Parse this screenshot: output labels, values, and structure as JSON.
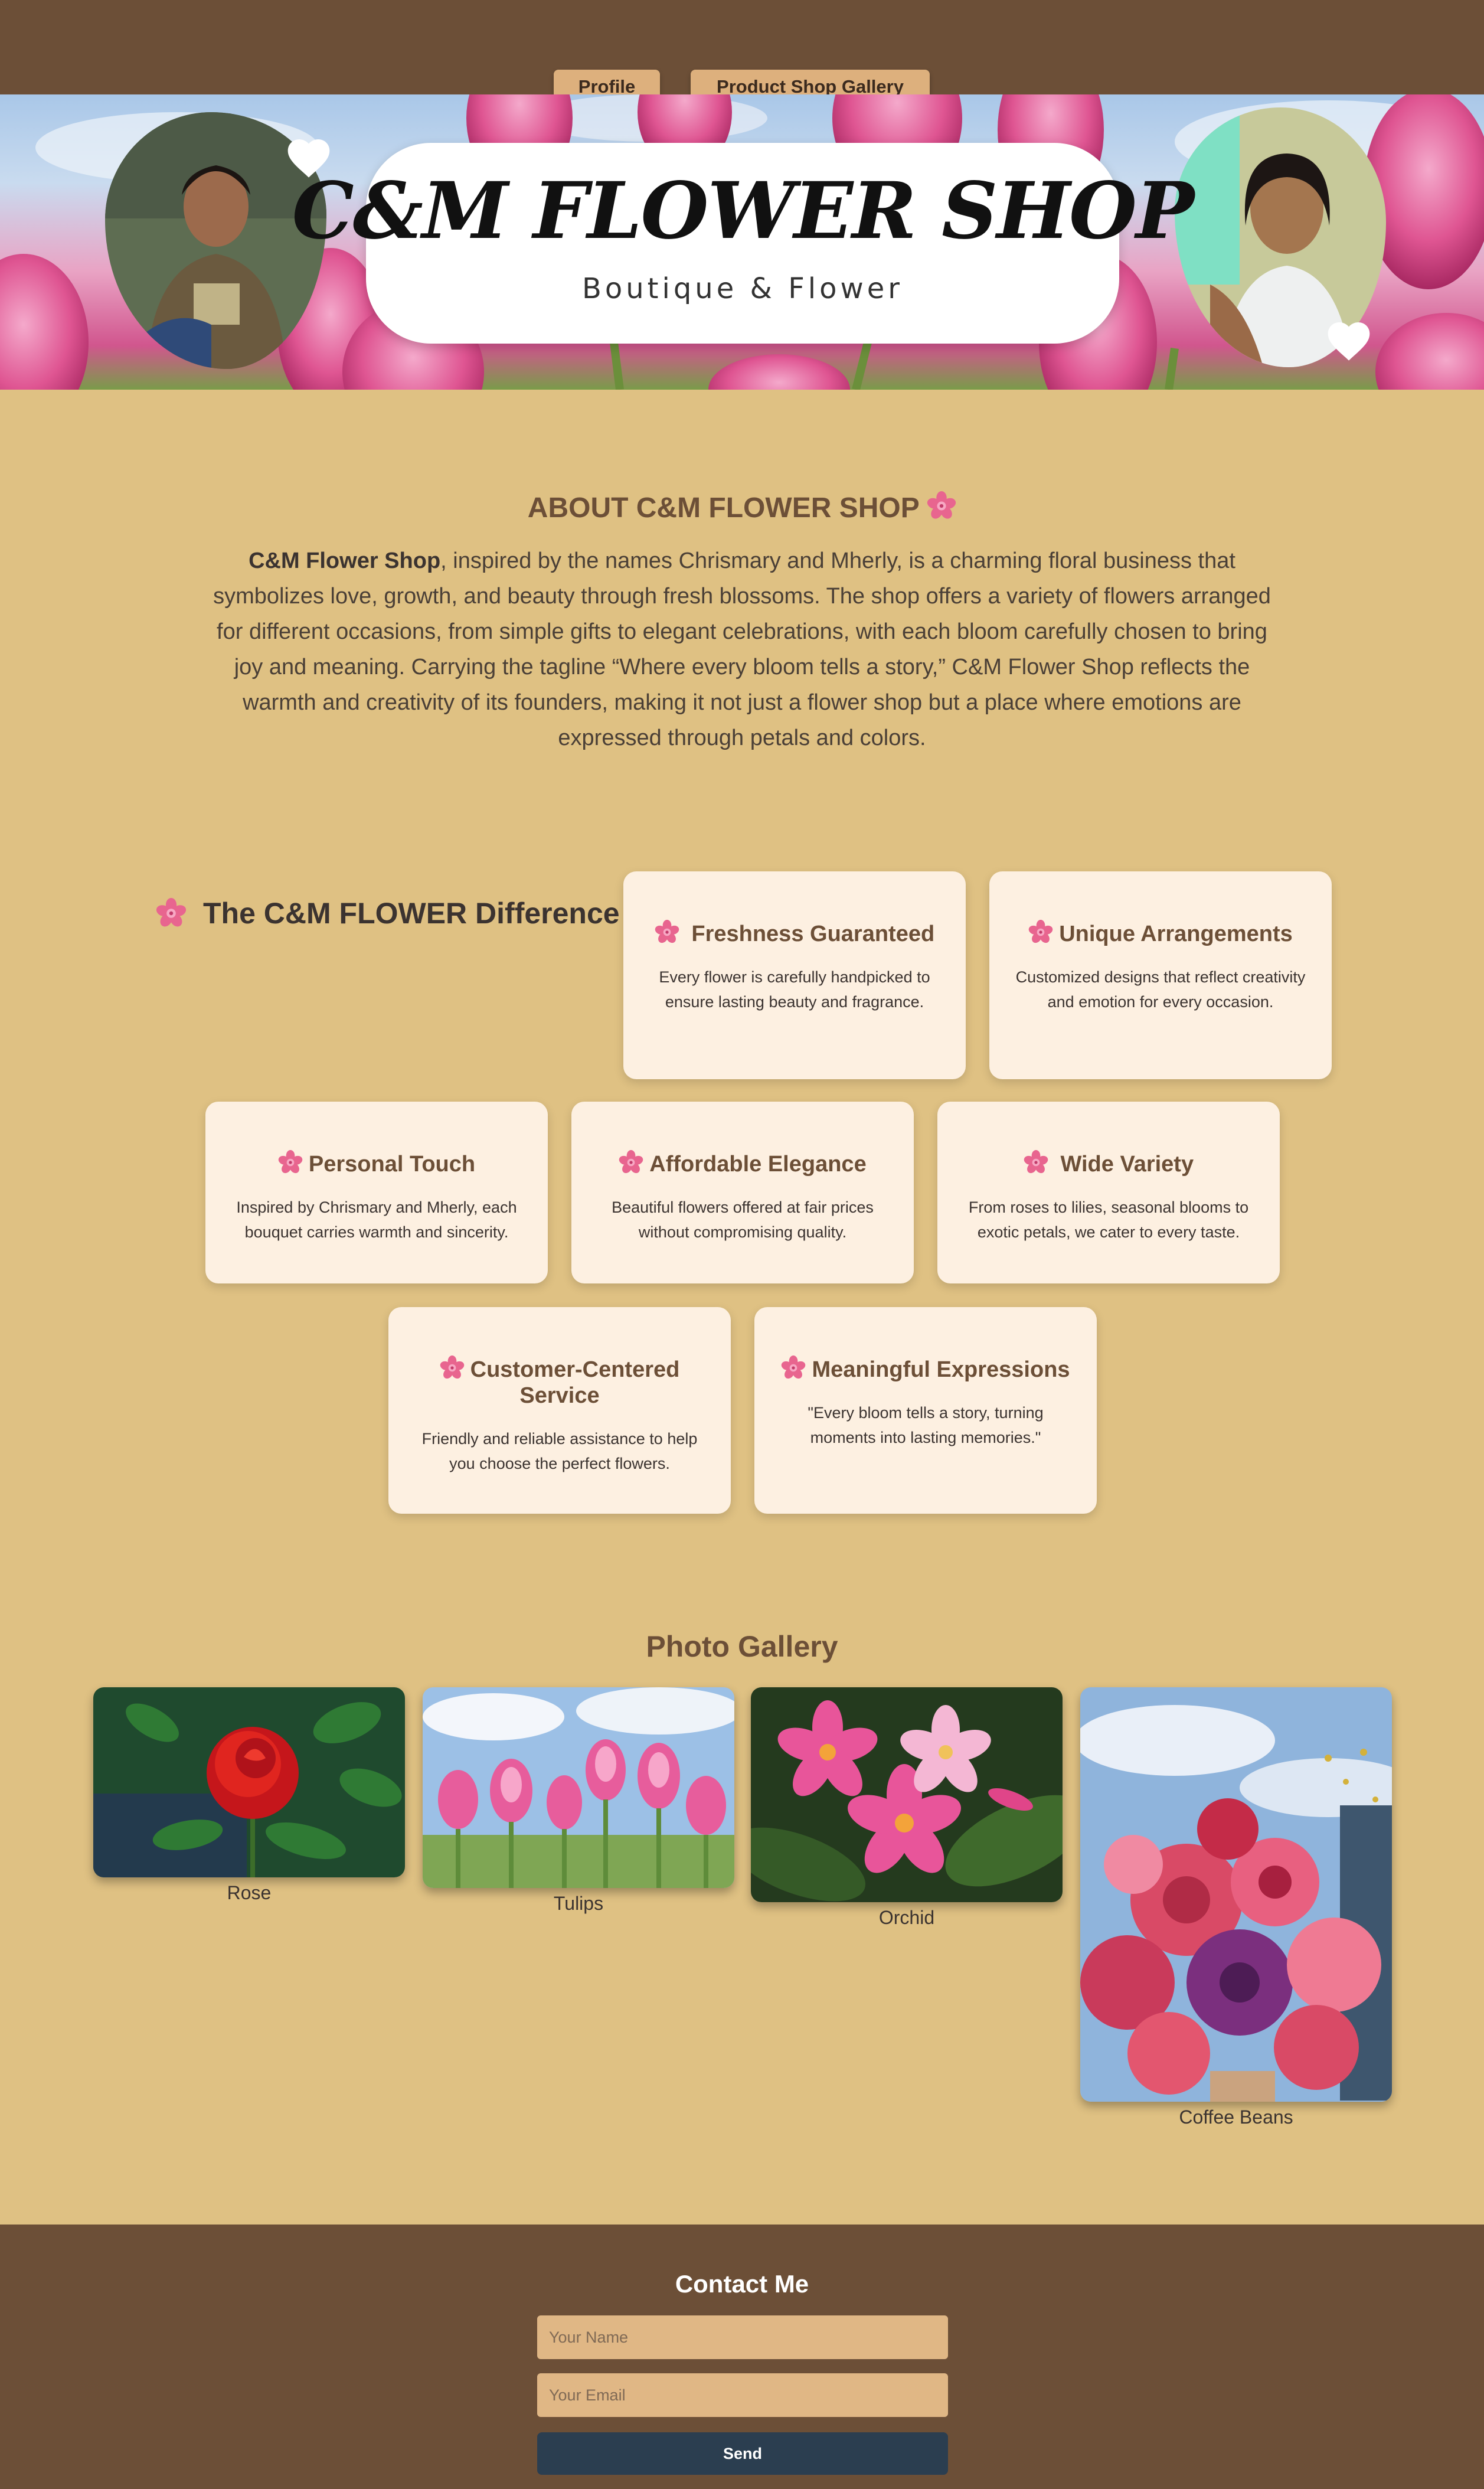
{
  "nav": {
    "profile_label": "Profile",
    "gallery_label": "Product Shop Gallery"
  },
  "hero": {
    "title": "C&M FLOWER SHOP",
    "subtitle": "Boutique & Flower"
  },
  "about": {
    "title": "ABOUT C&M FLOWER SHOP",
    "lead_bold": "C&M Flower Shop",
    "text": ", inspired by the names Chrismary and Mherly, is a charming floral business that symbolizes love, growth, and beauty through fresh blossoms. The shop offers a variety of flowers arranged for different occasions, from simple gifts to elegant celebrations, with each bloom carefully chosen to bring joy and meaning. Carrying the tagline “Where every bloom tells a story,” C&M Flower Shop reflects the warmth and creativity of its founders, making it not just a flower shop but a place where emotions are expressed through petals and colors."
  },
  "difference": {
    "heading": "The C&M FLOWER Difference",
    "cards": [
      {
        "title": "Freshness Guaranteed",
        "desc": "Every flower is carefully handpicked to ensure lasting beauty and fragrance."
      },
      {
        "title": "Unique Arrangements",
        "desc": "Customized designs that reflect creativity and emotion for every occasion."
      },
      {
        "title": "Personal Touch",
        "desc": "Inspired by Chrismary and Mherly, each bouquet carries warmth and sincerity."
      },
      {
        "title": "Affordable Elegance",
        "desc": "Beautiful flowers offered at fair prices without compromising quality."
      },
      {
        "title": "Wide Variety",
        "desc": "From roses to lilies, seasonal blooms to exotic petals, we cater to every taste."
      },
      {
        "title": "Customer-Centered Service",
        "desc": "Friendly and reliable assistance to help you choose the perfect flowers."
      },
      {
        "title": "Meaningful Expressions",
        "desc": "\"Every bloom tells a story, turning moments into lasting memories.\""
      }
    ]
  },
  "gallery": {
    "title": "Photo Gallery",
    "items": [
      {
        "caption": "Rose"
      },
      {
        "caption": "Tulips"
      },
      {
        "caption": "Orchid"
      },
      {
        "caption": "Coffee Beans"
      }
    ]
  },
  "contact": {
    "title": "Contact Me",
    "name_placeholder": "Your Name",
    "email_placeholder": "Your Email",
    "send_label": "Send"
  },
  "colors": {
    "background": "#dfc183",
    "brown": "#6c4f37",
    "card": "#fdf0e1",
    "button_dark": "#2b3e50",
    "field": "#e0b785",
    "flower_icon": "#e8658f"
  }
}
